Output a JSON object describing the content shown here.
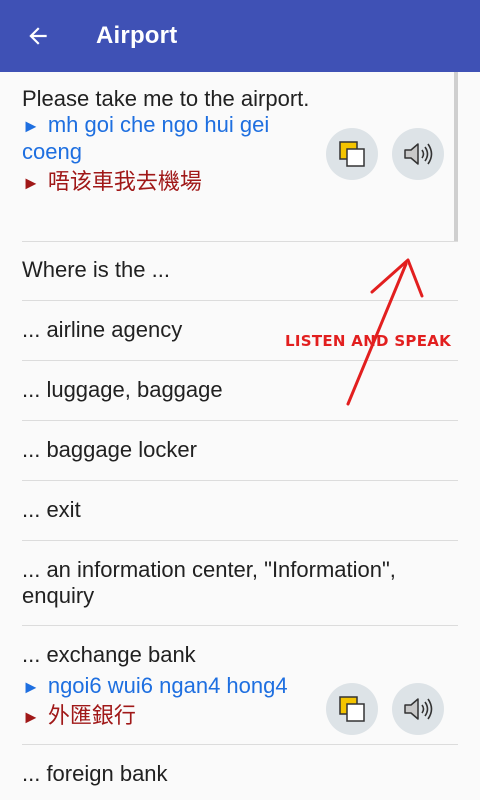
{
  "appbar": {
    "title": "Airport"
  },
  "rows": [
    {
      "english": "Please take me to the airport.",
      "translit": "mh goi che ngo hui gei coeng",
      "chinese": "唔该車我去機場"
    },
    {
      "english": "Where is the ..."
    },
    {
      "english": "... airline agency"
    },
    {
      "english": "... luggage, baggage"
    },
    {
      "english": "... baggage locker"
    },
    {
      "english": "... exit"
    },
    {
      "english": "... an information center, \"Information\", enquiry"
    },
    {
      "english": "... exchange bank",
      "translit": "ngoi6 wui6 ngan4 hong4",
      "chinese": "外匯銀行"
    },
    {
      "english": "... foreign bank"
    }
  ],
  "annotation": "LISTEN AND SPEAK",
  "marker": "►",
  "colors": {
    "appbar": "#3f51b5",
    "translit": "#1e6fe0",
    "chinese": "#a01818",
    "annotation": "#e21f1f"
  },
  "icons": [
    "back-arrow-icon",
    "copy-icon",
    "speaker-icon"
  ]
}
